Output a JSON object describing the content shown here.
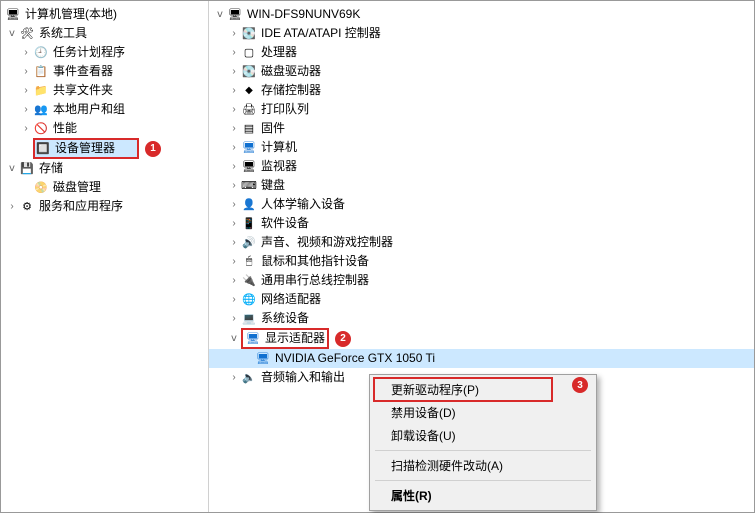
{
  "left": {
    "root": "计算机管理(本地)",
    "system_tools": "系统工具",
    "task_scheduler": "任务计划程序",
    "event_viewer": "事件查看器",
    "shared_folders": "共享文件夹",
    "local_users": "本地用户和组",
    "performance": "性能",
    "device_manager": "设备管理器",
    "storage": "存储",
    "disk_mgmt": "磁盘管理",
    "services_apps": "服务和应用程序"
  },
  "badges": {
    "b1": "1",
    "b2": "2",
    "b3": "3"
  },
  "right": {
    "host": "WIN-DFS9NUNV69K",
    "ide": "IDE ATA/ATAPI 控制器",
    "cpu": "处理器",
    "disk": "磁盘驱动器",
    "storage_ctrl": "存储控制器",
    "print_queue": "打印队列",
    "firmware": "固件",
    "computer": "计算机",
    "monitor": "监视器",
    "keyboard": "键盘",
    "hid": "人体学输入设备",
    "software_dev": "软件设备",
    "sound_video": "声音、视频和游戏控制器",
    "mouse": "鼠标和其他指针设备",
    "usb": "通用串行总线控制器",
    "network": "网络适配器",
    "system_dev": "系统设备",
    "display_adapter": "显示适配器",
    "gpu": "NVIDIA GeForce GTX 1050 Ti",
    "audio_io": "音频输入和输出"
  },
  "menu": {
    "update": "更新驱动程序(P)",
    "disable": "禁用设备(D)",
    "uninstall": "卸载设备(U)",
    "scan": "扫描检测硬件改动(A)",
    "properties": "属性(R)"
  }
}
